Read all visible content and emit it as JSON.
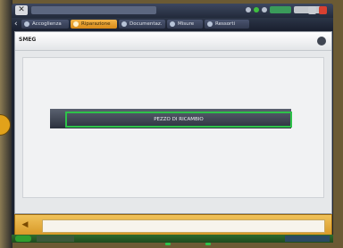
{
  "tabs": [
    {
      "label": "Accoglienza",
      "active": false
    },
    {
      "label": "Riparazione",
      "active": true
    },
    {
      "label": "Documentaz.",
      "active": false
    },
    {
      "label": "Misure",
      "active": false
    },
    {
      "label": "Ressorti",
      "active": false
    }
  ],
  "breadcrumb": "SMEG",
  "part_button_label": "PEZZO DI RICAMBIO",
  "colors": {
    "accent": "#e2a21a",
    "selection": "#2ec24a",
    "content_bg": "#e6e8ea"
  },
  "icons": {
    "app_close": "close-icon",
    "back": "back-arrow-icon",
    "help": "help-icon",
    "start": "start-icon"
  }
}
